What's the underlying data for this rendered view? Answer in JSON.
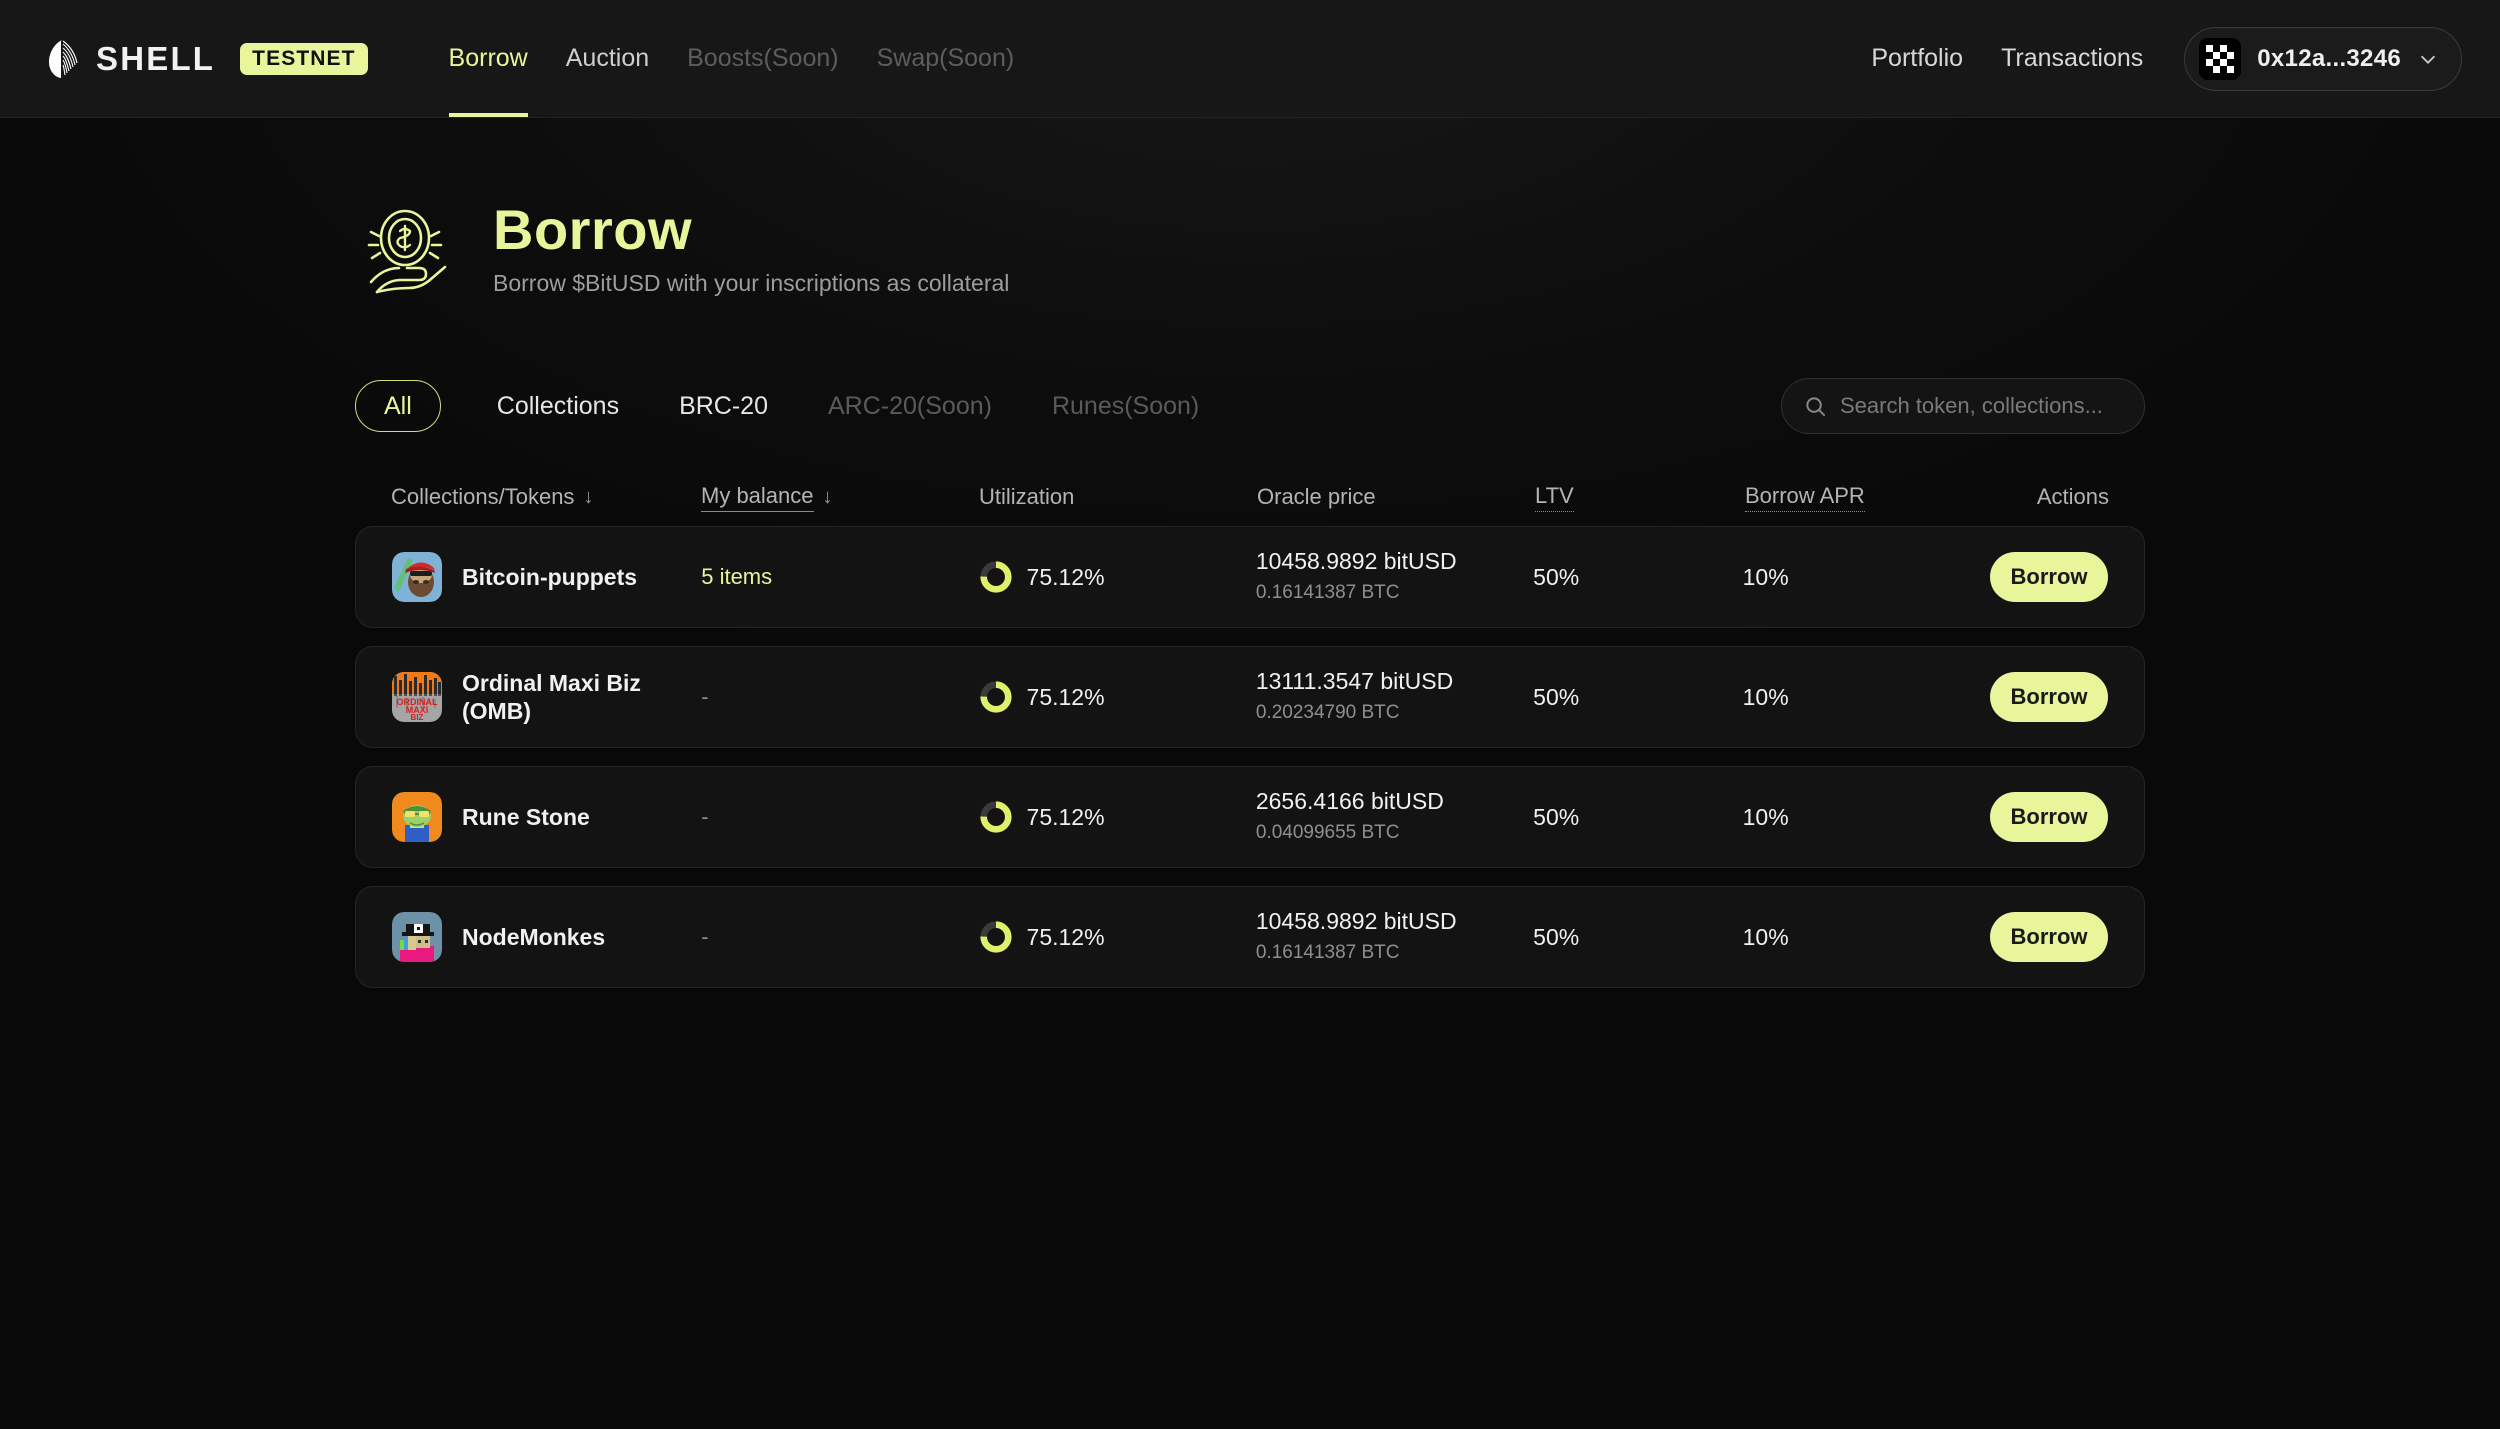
{
  "header": {
    "logo_text": "SHELL",
    "logo_icon": "shell-logo-icon",
    "testnet_badge": "TESTNET",
    "nav": [
      {
        "label": "Borrow",
        "state": "active"
      },
      {
        "label": "Auction",
        "state": "normal"
      },
      {
        "label": "Boosts(Soon)",
        "state": "soon"
      },
      {
        "label": "Swap(Soon)",
        "state": "soon"
      }
    ],
    "links": [
      {
        "label": "Portfolio"
      },
      {
        "label": "Transactions"
      }
    ],
    "wallet": {
      "address": "0x12a...3246",
      "avatar_icon": "identicon-icon",
      "chevron_icon": "chevron-down-icon"
    }
  },
  "hero": {
    "icon": "hand-holding-coin-icon",
    "title": "Borrow",
    "subtitle": "Borrow $BitUSD with your inscriptions as collateral"
  },
  "toolbar": {
    "filters": [
      {
        "label": "All",
        "state": "active"
      },
      {
        "label": "Collections",
        "state": "normal"
      },
      {
        "label": "BRC-20",
        "state": "normal"
      },
      {
        "label": "ARC-20(Soon)",
        "state": "soon"
      },
      {
        "label": "Runes(Soon)",
        "state": "soon"
      }
    ],
    "search": {
      "placeholder": "Search token, collections...",
      "value": "",
      "icon": "search-icon"
    }
  },
  "table": {
    "columns": [
      {
        "label": "Collections/Tokens",
        "sortable": true,
        "underline": "none"
      },
      {
        "label": "My balance",
        "sortable": true,
        "underline": "solid"
      },
      {
        "label": "Utilization",
        "sortable": false,
        "underline": "none"
      },
      {
        "label": "Oracle price",
        "sortable": false,
        "underline": "none"
      },
      {
        "label": "LTV",
        "sortable": false,
        "underline": "dotted"
      },
      {
        "label": "Borrow APR",
        "sortable": false,
        "underline": "dotted"
      },
      {
        "label": "Actions",
        "sortable": false,
        "underline": "none"
      }
    ],
    "sort_arrow": "↓",
    "rows": [
      {
        "name": "Bitcoin-puppets",
        "avatar": "bitcoin-puppets-avatar",
        "balance": "5 items",
        "balance_has_value": true,
        "utilization": "75.12%",
        "utilization_pct": 75.12,
        "price_usd": "10458.9892 bitUSD",
        "price_btc": "0.16141387 BTC",
        "ltv": "50%",
        "apr": "10%",
        "action": "Borrow"
      },
      {
        "name": "Ordinal Maxi Biz (OMB)",
        "avatar": "ordinal-maxi-biz-avatar",
        "balance": "-",
        "balance_has_value": false,
        "utilization": "75.12%",
        "utilization_pct": 75.12,
        "price_usd": "13111.3547 bitUSD",
        "price_btc": "0.20234790 BTC",
        "ltv": "50%",
        "apr": "10%",
        "action": "Borrow"
      },
      {
        "name": "Rune Stone",
        "avatar": "rune-stone-avatar",
        "balance": "-",
        "balance_has_value": false,
        "utilization": "75.12%",
        "utilization_pct": 75.12,
        "price_usd": "2656.4166 bitUSD",
        "price_btc": "0.04099655 BTC",
        "ltv": "50%",
        "apr": "10%",
        "action": "Borrow"
      },
      {
        "name": "NodeMonkes",
        "avatar": "nodemonkes-avatar",
        "balance": "-",
        "balance_has_value": false,
        "utilization": "75.12%",
        "utilization_pct": 75.12,
        "price_usd": "10458.9892 bitUSD",
        "price_btc": "0.16141387 BTC",
        "ltv": "50%",
        "apr": "10%",
        "action": "Borrow"
      }
    ]
  },
  "colors": {
    "accent": "#e8f59a",
    "page_bg": "#0a0a0a",
    "header_bg": "#171717",
    "row_bg": "#131313",
    "row_border": "#242424",
    "muted_text": "#8a8a8a",
    "donut_track": "#3a3a3a"
  }
}
